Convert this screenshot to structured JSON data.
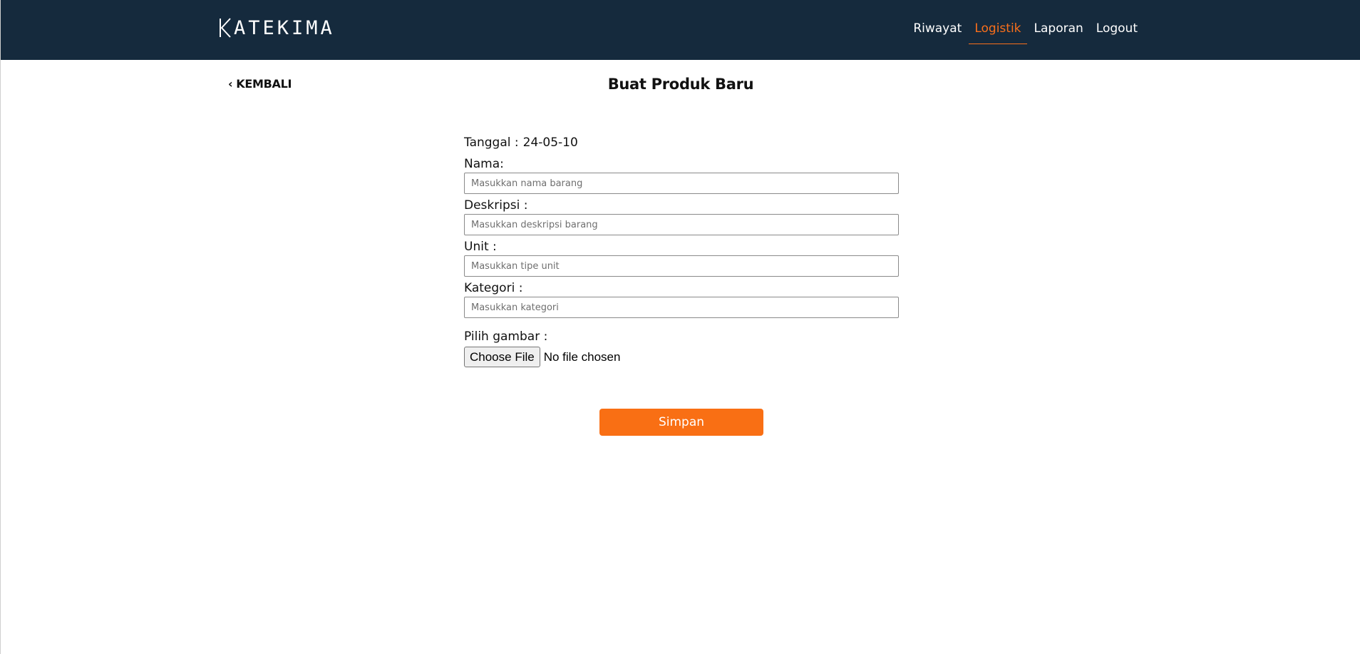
{
  "header": {
    "logo_text": "ATEKIMA",
    "logo_letter": "K",
    "nav": [
      {
        "label": "Riwayat",
        "active": false
      },
      {
        "label": "Logistik",
        "active": true
      },
      {
        "label": "Laporan",
        "active": false
      },
      {
        "label": "Logout",
        "active": false
      }
    ]
  },
  "page": {
    "back_label": "KEMBALI",
    "title": "Buat Produk Baru"
  },
  "form": {
    "date_label": "Tanggal :",
    "date_value": "24-05-10",
    "fields": [
      {
        "label": "Nama:",
        "placeholder": "Masukkan nama barang",
        "value": ""
      },
      {
        "label": "Deskripsi :",
        "placeholder": "Masukkan deskripsi barang",
        "value": ""
      },
      {
        "label": "Unit :",
        "placeholder": "Masukkan tipe unit",
        "value": ""
      },
      {
        "label": "Kategori :",
        "placeholder": "Masukkan kategori",
        "value": ""
      }
    ],
    "image": {
      "label": "Pilih gambar :",
      "button_label": "Choose File",
      "status": "No file chosen"
    },
    "submit_label": "Simpan"
  },
  "colors": {
    "header_bg": "#152a3d",
    "accent": "#f96f14",
    "text": "#111111"
  },
  "icons": {
    "back": "chevron-left-icon",
    "logo": "logo-k-icon"
  }
}
